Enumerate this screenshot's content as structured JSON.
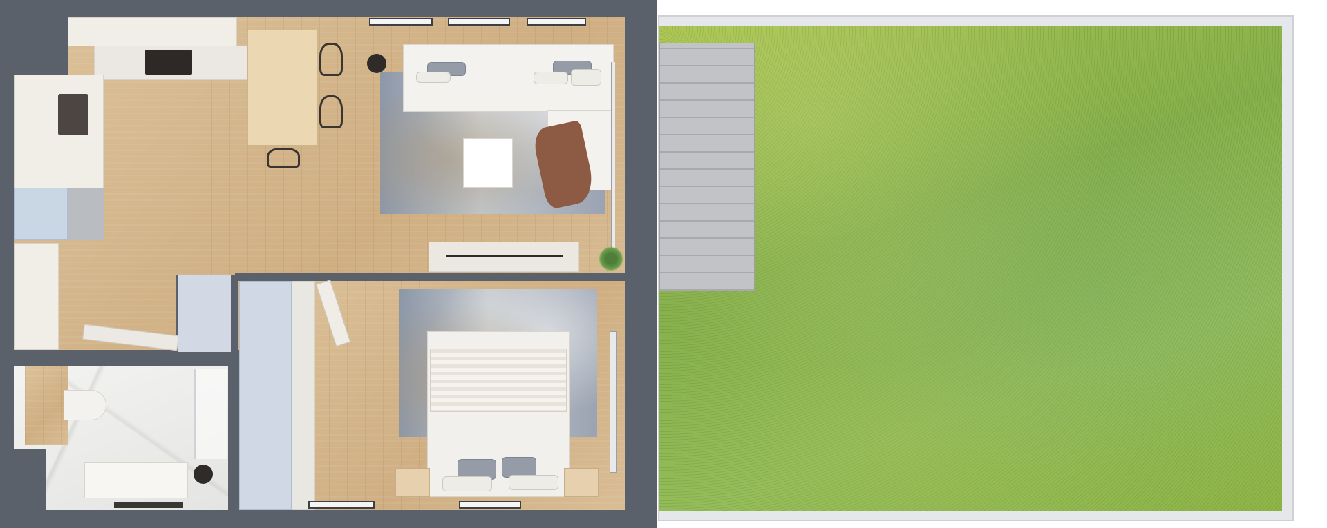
{
  "plan": {
    "rooms": [
      "living-kitchen",
      "bedroom",
      "bathroom",
      "garden"
    ],
    "colors": {
      "walls": "#5b616b",
      "wood_floor": "#d7b88e",
      "lawn": "#8fb54a",
      "deck": "#b7b8bc",
      "rug": "#9aa3b2"
    }
  }
}
